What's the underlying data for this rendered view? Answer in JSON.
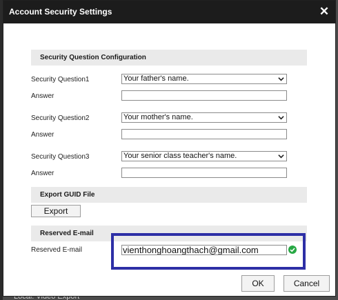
{
  "dialog": {
    "title": "Account Security Settings",
    "close_symbol": "✕"
  },
  "security_questions": {
    "section_title": "Security Question Configuration",
    "items": [
      {
        "label": "Security Question1",
        "selected": "Your father's name.",
        "answer_label": "Answer",
        "answer_value": ""
      },
      {
        "label": "Security Question2",
        "selected": "Your mother's name.",
        "answer_label": "Answer",
        "answer_value": ""
      },
      {
        "label": "Security Question3",
        "selected": "Your senior class teacher's name.",
        "answer_label": "Answer",
        "answer_value": ""
      }
    ]
  },
  "export_guid": {
    "section_title": "Export GUID File",
    "button_label": "Export"
  },
  "reserved_email": {
    "section_title": "Reserved E-mail",
    "label": "Reserved E-mail",
    "value": "vienthonghoangthach@gmail.com"
  },
  "footer": {
    "ok_label": "OK",
    "cancel_label": "Cancel"
  },
  "background": {
    "peek_text": "Local: Video Export"
  },
  "colors": {
    "titlebar": "#1c1c1c",
    "section_header_bg": "#eaeaea",
    "highlight_border": "#2d2fa6",
    "valid_check": "#27a844"
  },
  "icons": {
    "close": "close-icon",
    "dropdown": "chevron-down-icon",
    "valid": "check-circle-icon"
  }
}
